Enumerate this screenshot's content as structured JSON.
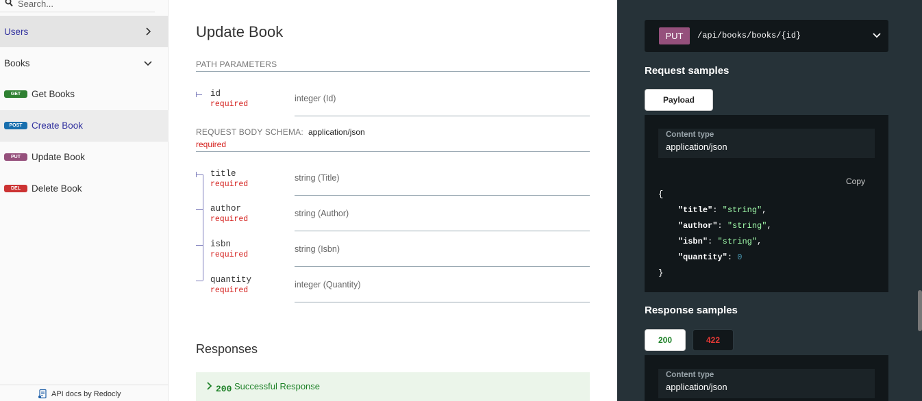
{
  "search": {
    "placeholder": "Search..."
  },
  "sidebar": {
    "groups": [
      {
        "label": "Users"
      },
      {
        "label": "Books"
      }
    ],
    "operations": [
      {
        "method": "GET",
        "method_color": "#2f8132",
        "label": "Get Books"
      },
      {
        "method": "POST",
        "method_color": "#186fae",
        "label": "Create Book"
      },
      {
        "method": "PUT",
        "method_color": "#95507c",
        "label": "Update Book"
      },
      {
        "method": "DEL",
        "method_color": "#cc3333",
        "label": "Delete Book"
      }
    ],
    "footer": "API docs by Redocly"
  },
  "main": {
    "title": "Update Book",
    "path_params_label": "PATH PARAMETERS",
    "path_params": [
      {
        "name": "id",
        "required": "required",
        "type": "integer (Id)"
      }
    ],
    "body_schema_label": "REQUEST BODY SCHEMA:",
    "body_mime": "application/json",
    "body_required": "required",
    "body_params": [
      {
        "name": "title",
        "required": "required",
        "type": "string (Title)"
      },
      {
        "name": "author",
        "required": "required",
        "type": "string (Author)"
      },
      {
        "name": "isbn",
        "required": "required",
        "type": "string (Isbn)"
      },
      {
        "name": "quantity",
        "required": "required",
        "type": "integer (Quantity)"
      }
    ],
    "responses_title": "Responses",
    "response_200": {
      "code": "200",
      "desc": "Successful Response"
    }
  },
  "right": {
    "method": "PUT",
    "path": "/api/books/books/{id}",
    "request_samples_title": "Request samples",
    "payload_tab": "Payload",
    "content_type_label": "Content type",
    "content_type_value": "application/json",
    "copy": "Copy",
    "code": {
      "open": "{",
      "close": "}",
      "lines": [
        {
          "key": "\"title\"",
          "sep": ": ",
          "val": "\"string\"",
          "kind": "s",
          "comma": ","
        },
        {
          "key": "\"author\"",
          "sep": ": ",
          "val": "\"string\"",
          "kind": "s",
          "comma": ","
        },
        {
          "key": "\"isbn\"",
          "sep": ": ",
          "val": "\"string\"",
          "kind": "s",
          "comma": ","
        },
        {
          "key": "\"quantity\"",
          "sep": ": ",
          "val": "0",
          "kind": "n",
          "comma": ""
        }
      ]
    },
    "response_samples_title": "Response samples",
    "resp_tabs": [
      {
        "label": "200"
      },
      {
        "label": "422"
      }
    ],
    "resp_content_type_label": "Content type",
    "resp_content_type_value": "application/json"
  }
}
